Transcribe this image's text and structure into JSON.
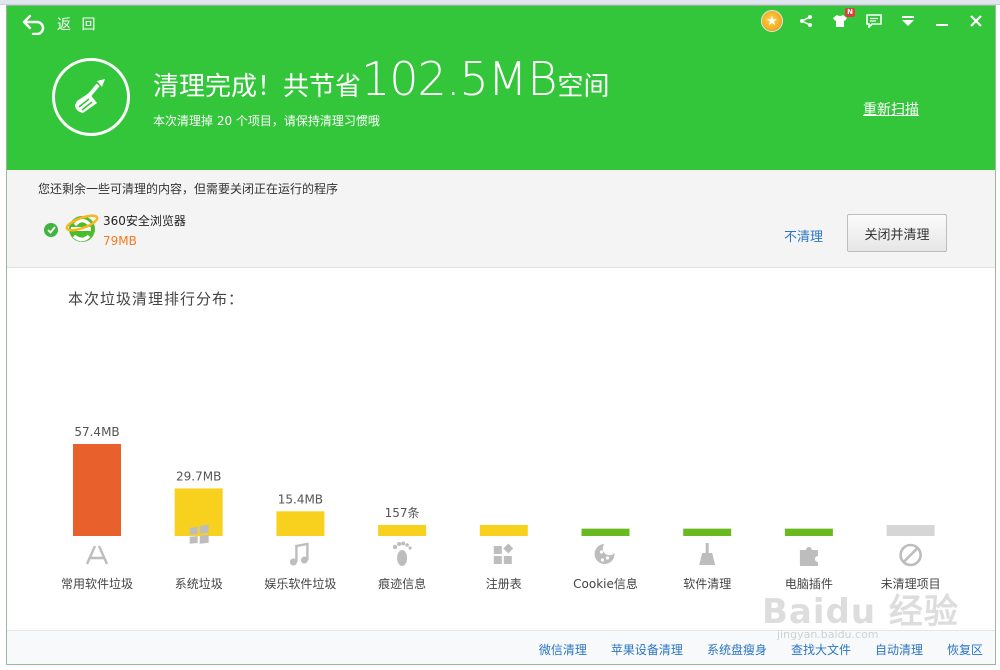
{
  "header": {
    "back_label": "返 回",
    "headline_prefix": "清理完成！共节省",
    "headline_number": "102.5",
    "headline_unit": "MB",
    "headline_suffix": "空间",
    "subline": "本次清理掉 20 个项目，请保持清理习惯哦",
    "rescan_label": "重新扫描",
    "badge_text": "N",
    "icons": [
      "medal-icon",
      "share-icon",
      "shirt-icon",
      "message-icon",
      "menu-down-icon",
      "minimize-icon",
      "close-icon"
    ]
  },
  "running": {
    "note": "您还剩余一些可清理的内容，但需要关闭正在运行的程序",
    "program_name": "360安全浏览器",
    "program_size": "79MB",
    "no_clean_label": "不清理",
    "close_clean_label": "关闭并清理"
  },
  "chart_title": "本次垃圾清理排行分布：",
  "chart_data": {
    "type": "bar",
    "title": "本次垃圾清理排行分布：",
    "categories": [
      "常用软件垃圾",
      "系统垃圾",
      "娱乐软件垃圾",
      "痕迹信息",
      "注册表",
      "Cookie信息",
      "软件清理",
      "电脑插件",
      "未清理项目"
    ],
    "values_mb": [
      57.4,
      29.7,
      15.4,
      null,
      null,
      null,
      null,
      null,
      null
    ],
    "value_labels": [
      "57.4MB",
      "29.7MB",
      "15.4MB",
      "157条",
      "",
      "",
      "",
      "",
      ""
    ],
    "icons": [
      "app-store-icon",
      "windows-icon",
      "music-icon",
      "footprint-icon",
      "registry-icon",
      "cookie-icon",
      "broom-icon",
      "puzzle-icon",
      "forbidden-icon"
    ],
    "colors": [
      "#e8602c",
      "#f8d11e",
      "#f8d11e",
      "#f8d11e",
      "#f8d11e",
      "#6ab91f",
      "#6ab91f",
      "#6ab91f",
      "#d6d6d6"
    ],
    "min_bar_fraction": [
      null,
      null,
      null,
      0.12,
      0.12,
      0.08,
      0.08,
      0.08,
      0.12
    ]
  },
  "footer": {
    "links": [
      "微信清理",
      "苹果设备清理",
      "系统盘瘦身",
      "查找大文件",
      "自动清理",
      "恢复区"
    ]
  },
  "watermark": "Baidu 经验",
  "watermark_sub": "jingyan.baidu.com"
}
